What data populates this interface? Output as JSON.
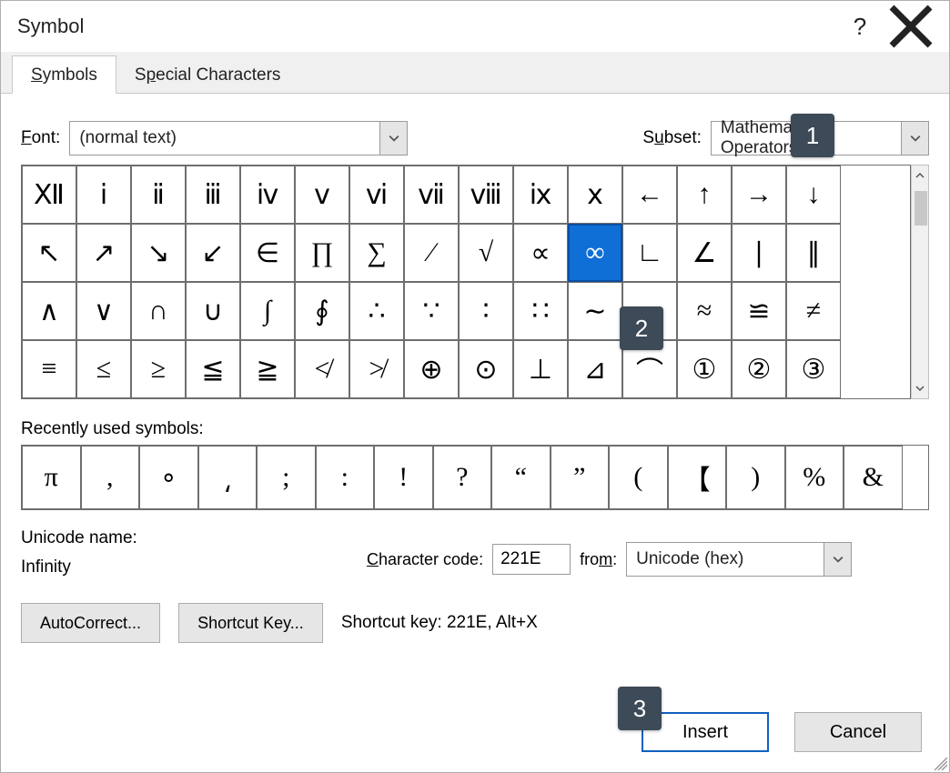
{
  "title": "Symbol",
  "tabs": {
    "symbols": "Symbols",
    "special": "Special Characters"
  },
  "labels": {
    "font": "Font:",
    "subset": "Subset:",
    "recent": "Recently used symbols:",
    "unicode_name": "Unicode name:",
    "char_code": "Character code:",
    "from": "from:",
    "shortcut_key": "Shortcut key:"
  },
  "font_value": "(normal text)",
  "subset_value": "Mathematical Operators",
  "char_code_value": "221E",
  "from_value": "Unicode (hex)",
  "unicode_name_value": "Infinity",
  "shortcut_value": "221E, Alt+X",
  "buttons": {
    "autocorrect": "AutoCorrect...",
    "shortcut": "Shortcut Key...",
    "insert": "Insert",
    "cancel": "Cancel"
  },
  "callouts": [
    "1",
    "2",
    "3"
  ],
  "grid": [
    [
      "Ⅻ",
      "ⅰ",
      "ⅱ",
      "ⅲ",
      "ⅳ",
      "ⅴ",
      "ⅵ",
      "ⅶ",
      "ⅷ",
      "ⅸ",
      "ⅹ",
      "←",
      "↑",
      "→",
      "↓"
    ],
    [
      "↖",
      "↗",
      "↘",
      "↙",
      "∈",
      "∏",
      "∑",
      "∕",
      "√",
      "∝",
      "∞",
      "∟",
      "∠",
      "∣",
      "∥"
    ],
    [
      "∧",
      "∨",
      "∩",
      "∪",
      "∫",
      "∮",
      "∴",
      "∵",
      "∶",
      "∷",
      "∼",
      "≃",
      "≈",
      "≌",
      "≠"
    ],
    [
      "≡",
      "≤",
      "≥",
      "≦",
      "≧",
      "≮",
      "≯",
      "⊕",
      "⊙",
      "⊥",
      "⊿",
      "⌒",
      "①",
      "②",
      "③"
    ]
  ],
  "grid_selected": [
    1,
    10
  ],
  "recent": [
    "π",
    ",",
    "∘",
    "⸲",
    ";",
    ":",
    "!",
    "?",
    "“",
    "”",
    "(",
    "【",
    ")",
    "%",
    "&"
  ]
}
